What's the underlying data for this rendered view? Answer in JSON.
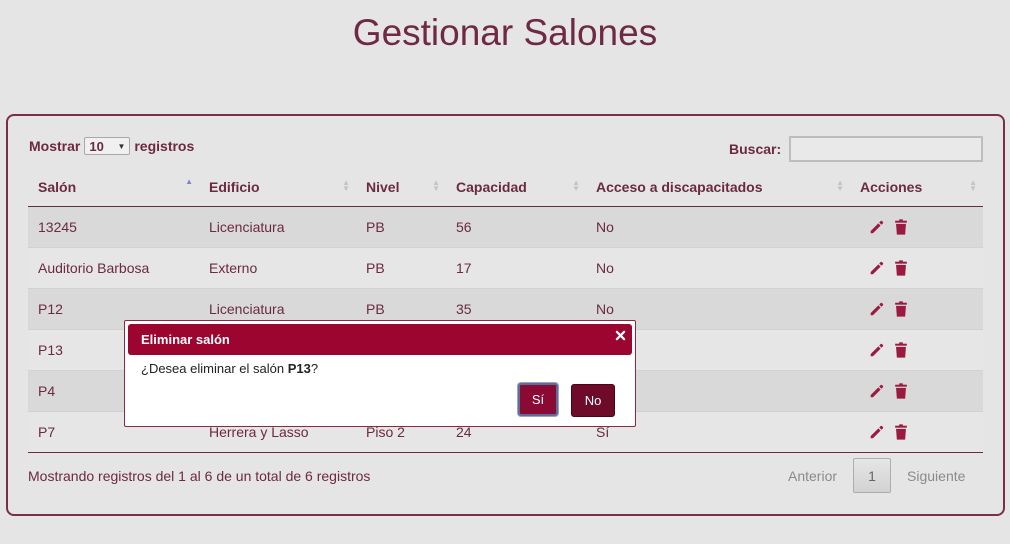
{
  "page": {
    "title": "Gestionar Salones"
  },
  "length": {
    "prefix": "Mostrar",
    "selected": "10",
    "suffix": "registros"
  },
  "search": {
    "label": "Buscar:",
    "value": ""
  },
  "table": {
    "headers": [
      "Salón",
      "Edificio",
      "Nivel",
      "Capacidad",
      "Acceso a discapacitados",
      "Acciones"
    ],
    "rows": [
      [
        "13245",
        "Licenciatura",
        "PB",
        "56",
        "No"
      ],
      [
        "Auditorio Barbosa",
        "Externo",
        "PB",
        "17",
        "No"
      ],
      [
        "P12",
        "Licenciatura",
        "PB",
        "35",
        "No"
      ],
      [
        "P13",
        "",
        "",
        "",
        ""
      ],
      [
        "P4",
        "",
        "",
        "",
        ""
      ],
      [
        "P7",
        "Herrera y Lasso",
        "Piso 2",
        "24",
        "Sí"
      ]
    ]
  },
  "footer": {
    "info": "Mostrando registros del 1 al 6 de un total de 6 registros",
    "prev": "Anterior",
    "page": "1",
    "next": "Siguiente"
  },
  "modal": {
    "title": "Eliminar salón",
    "message_prefix": "¿Desea eliminar el salón ",
    "message_target": "P13",
    "message_suffix": "?",
    "yes": "Sí",
    "no": "No"
  },
  "icons": {
    "edit": "pencil-icon",
    "delete": "trash-icon"
  },
  "colors": {
    "accent": "#9b0530",
    "text": "#6b2a3e",
    "icon": "#9b1a40"
  }
}
